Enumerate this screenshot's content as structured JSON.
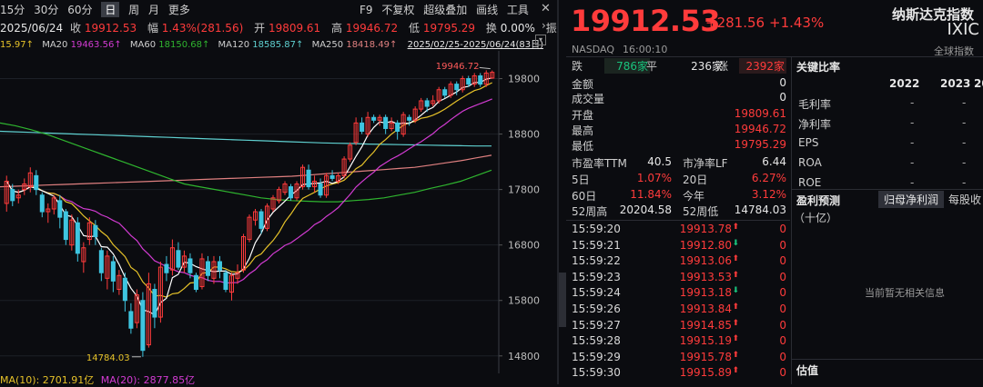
{
  "toolbar": {
    "period_tabs": [
      "15分",
      "30分",
      "60分",
      "日",
      "周",
      "月",
      "更多"
    ],
    "date": "2025/06/24",
    "close_label": "收",
    "close_value": "19912.53",
    "range_label": "幅",
    "range_value": "1.43%(281.56)",
    "open_label": "开",
    "open_value": "19809.61",
    "high_label": "高",
    "high_value": "19946.72",
    "low_label": "低",
    "low_value": "19795.29",
    "turnover_label": "换",
    "turnover_value": "0.00%",
    "more_label": "振",
    "f9": "F9",
    "fuquan": "不复权",
    "overlay": "超级叠加",
    "draw": "画线",
    "tools": "工具"
  },
  "ma_legend": {
    "ma5": "15.97↑",
    "ma20_label": "MA20",
    "ma20": "19463.56↑",
    "ma60_label": "MA60",
    "ma60": "18150.68↑",
    "ma120_label": "MA120",
    "ma120": "18585.87↑",
    "ma250_label": "MA250",
    "ma250": "18418.49↑",
    "range": "2025/02/25-2025/06/24(83日)"
  },
  "volume_legend": {
    "ma10": "MA(10): 2701.91亿",
    "ma20": "MA(20): 2877.85亿"
  },
  "chart_data": {
    "type": "candlestick",
    "y_ticks": [
      "19800",
      "18800",
      "17800",
      "16800",
      "15800",
      "14800"
    ],
    "ylim": [
      14600,
      20300
    ],
    "high_annotation": "19946.72",
    "low_annotation": "14784.03",
    "candles": [
      [
        17550,
        17950,
        17400,
        18050
      ],
      [
        17800,
        17600,
        17500,
        17900
      ],
      [
        17650,
        17700,
        17550,
        17800
      ],
      [
        17800,
        17900,
        17700,
        18000
      ],
      [
        17850,
        18100,
        17750,
        18200
      ],
      [
        18050,
        17800,
        17700,
        18150
      ],
      [
        17700,
        17400,
        17300,
        17750
      ],
      [
        17400,
        17450,
        17200,
        17550
      ],
      [
        17450,
        17650,
        17350,
        17700
      ],
      [
        17600,
        17300,
        17100,
        17700
      ],
      [
        17400,
        16900,
        16800,
        17450
      ],
      [
        16800,
        17250,
        16700,
        17350
      ],
      [
        17200,
        16650,
        16500,
        17300
      ],
      [
        16500,
        16750,
        16300,
        16850
      ],
      [
        16900,
        17200,
        16800,
        17300
      ],
      [
        17150,
        16950,
        16800,
        17250
      ],
      [
        16700,
        16300,
        16150,
        16750
      ],
      [
        16200,
        16600,
        16000,
        16700
      ],
      [
        16500,
        16150,
        15950,
        16600
      ],
      [
        16000,
        16250,
        15900,
        16350
      ],
      [
        16200,
        15800,
        15600,
        16300
      ],
      [
        15600,
        15300,
        15200,
        15750
      ],
      [
        15400,
        15900,
        15300,
        16000
      ],
      [
        15800,
        14900,
        14784,
        15950
      ],
      [
        15000,
        16100,
        14950,
        16300
      ],
      [
        16000,
        15500,
        15300,
        16100
      ],
      [
        15500,
        16400,
        15400,
        16500
      ],
      [
        16450,
        16300,
        16150,
        16600
      ],
      [
        16350,
        16750,
        16250,
        16900
      ],
      [
        16700,
        16400,
        16350,
        16850
      ],
      [
        16400,
        16600,
        16300,
        16700
      ],
      [
        16550,
        16300,
        16200,
        16650
      ],
      [
        16250,
        16000,
        15950,
        16300
      ],
      [
        16050,
        16550,
        16000,
        16650
      ],
      [
        16500,
        16250,
        16150,
        16600
      ],
      [
        16200,
        16500,
        16100,
        16600
      ],
      [
        16500,
        16350,
        16200,
        16600
      ],
      [
        16300,
        16000,
        15950,
        16350
      ],
      [
        15950,
        16250,
        15800,
        16300
      ],
      [
        16200,
        16300,
        16100,
        16450
      ],
      [
        16350,
        16950,
        16300,
        17000
      ],
      [
        16900,
        17300,
        16850,
        17350
      ],
      [
        17250,
        17400,
        17150,
        17450
      ],
      [
        17400,
        17100,
        17000,
        17450
      ],
      [
        17100,
        17500,
        17050,
        17550
      ],
      [
        17450,
        17650,
        17400,
        17700
      ],
      [
        17600,
        17800,
        17550,
        17850
      ],
      [
        17750,
        17900,
        17700,
        17950
      ],
      [
        17850,
        17650,
        17600,
        17900
      ],
      [
        17650,
        17900,
        17600,
        17950
      ],
      [
        17850,
        18200,
        17800,
        18250
      ],
      [
        18150,
        17850,
        17800,
        18250
      ],
      [
        17850,
        17950,
        17750,
        18050
      ],
      [
        17900,
        17700,
        17650,
        18000
      ],
      [
        17700,
        18050,
        17650,
        18100
      ],
      [
        18050,
        18000,
        17950,
        18150
      ],
      [
        17950,
        18050,
        17900,
        18100
      ],
      [
        18050,
        18350,
        18000,
        18400
      ],
      [
        18350,
        18600,
        18300,
        18650
      ],
      [
        18650,
        19000,
        18600,
        19100
      ],
      [
        19000,
        18850,
        18800,
        19100
      ],
      [
        18800,
        19100,
        18750,
        19200
      ],
      [
        19100,
        19050,
        19000,
        19150
      ],
      [
        19050,
        19100,
        18950,
        19150
      ],
      [
        19100,
        18900,
        18800,
        19150
      ],
      [
        18900,
        19000,
        18850,
        19100
      ],
      [
        19000,
        18850,
        18700,
        19050
      ],
      [
        18800,
        19150,
        18750,
        19200
      ],
      [
        19100,
        19050,
        18950,
        19150
      ],
      [
        19050,
        19250,
        19000,
        19300
      ],
      [
        19250,
        19400,
        19200,
        19450
      ],
      [
        19400,
        19300,
        19200,
        19450
      ],
      [
        19350,
        19400,
        19300,
        19500
      ],
      [
        19400,
        19600,
        19350,
        19650
      ],
      [
        19600,
        19500,
        19450,
        19650
      ],
      [
        19500,
        19700,
        19450,
        19750
      ],
      [
        19700,
        19600,
        19500,
        19750
      ],
      [
        19600,
        19800,
        19550,
        19850
      ],
      [
        19800,
        19700,
        19650,
        19850
      ],
      [
        19700,
        19850,
        19650,
        19900
      ],
      [
        19850,
        19700,
        19650,
        19900
      ],
      [
        19700,
        19900,
        19650,
        19950
      ],
      [
        19809.61,
        19912.53,
        19795.29,
        19946.72
      ]
    ],
    "ma_colors": {
      "ma5": "#ffffff",
      "ma10": "#e6c229",
      "ma20": "#d23bd2",
      "ma60": "#2fb52f",
      "ma120": "#5fd0d0",
      "ma250": "#e08080"
    },
    "ma_lines": {
      "ma120": [
        18850,
        18840,
        18830,
        18820,
        18810,
        18800,
        18790,
        18780,
        18770,
        18760,
        18750,
        18740,
        18730,
        18720,
        18710,
        18700,
        18690,
        18680,
        18670,
        18660,
        18650,
        18640,
        18635,
        18630,
        18620,
        18615,
        18610,
        18605,
        18600,
        18595,
        18590,
        18585,
        18585
      ],
      "ma250": [
        17850,
        17860,
        17870,
        17880,
        17890,
        17900,
        17910,
        17920,
        17930,
        17940,
        17950,
        17960,
        17970,
        17980,
        17990,
        18000,
        18010,
        18020,
        18030,
        18040,
        18060,
        18080,
        18100,
        18120,
        18140,
        18160,
        18180,
        18200,
        18240,
        18280,
        18320,
        18370,
        18418
      ],
      "ma60": [
        19000,
        18950,
        18880,
        18800,
        18700,
        18600,
        18500,
        18400,
        18300,
        18200,
        18100,
        18000,
        17900,
        17850,
        17800,
        17750,
        17700,
        17650,
        17620,
        17600,
        17590,
        17580,
        17580,
        17600,
        17620,
        17650,
        17700,
        17750,
        17820,
        17880,
        17950,
        18050,
        18150
      ]
    }
  },
  "quote": {
    "price": "19912.53",
    "change": "+281.56",
    "change_pct": "+1.43%",
    "name": "纳斯达克指数",
    "code": "IXIC",
    "exchange": "NASDAQ",
    "time": "16:00:10",
    "global": "全球指数"
  },
  "breadth": {
    "down_label": "跌",
    "down": "786家",
    "flat_label": "平",
    "flat": "236家",
    "up_label": "涨",
    "up": "2392家"
  },
  "stats": {
    "amount_label": "金额",
    "amount": "0",
    "volume_label": "成交量",
    "volume": "0",
    "open_label": "开盘",
    "open": "19809.61",
    "high_label": "最高",
    "high": "19946.72",
    "low_label": "最低",
    "low": "19795.29",
    "pe_label": "市盈率TTM",
    "pe": "40.5",
    "pb_label": "市净率LF",
    "pb": "6.44",
    "d5_label": "5日",
    "d5": "1.07%",
    "d20_label": "20日",
    "d20": "6.27%",
    "d60_label": "60日",
    "d60": "11.84%",
    "ytd_label": "今年",
    "ytd": "3.12%",
    "w52h_label": "52周高",
    "w52h": "20204.58",
    "w52l_label": "52周低",
    "w52l": "14784.03"
  },
  "ticks": [
    {
      "time": "15:59:20",
      "price": "19913.78",
      "dir": "up",
      "vol": "0"
    },
    {
      "time": "15:59:21",
      "price": "19912.80",
      "dir": "down",
      "vol": "0"
    },
    {
      "time": "15:59:22",
      "price": "19913.06",
      "dir": "up",
      "vol": "0"
    },
    {
      "time": "15:59:23",
      "price": "19913.53",
      "dir": "up",
      "vol": "0"
    },
    {
      "time": "15:59:24",
      "price": "19913.18",
      "dir": "down",
      "vol": "0"
    },
    {
      "time": "15:59:26",
      "price": "19913.84",
      "dir": "up",
      "vol": "0"
    },
    {
      "time": "15:59:27",
      "price": "19914.85",
      "dir": "up",
      "vol": "0"
    },
    {
      "time": "15:59:28",
      "price": "19915.19",
      "dir": "up",
      "vol": "0"
    },
    {
      "time": "15:59:29",
      "price": "19915.78",
      "dir": "up",
      "vol": "0"
    },
    {
      "time": "15:59:30",
      "price": "19915.89",
      "dir": "up",
      "vol": "0"
    }
  ],
  "ratios": {
    "title": "关键比率",
    "years": [
      "2022",
      "2023",
      "20"
    ],
    "rows": [
      {
        "label": "毛利率",
        "vals": [
          "-",
          "-"
        ]
      },
      {
        "label": "净利率",
        "vals": [
          "-",
          "-"
        ]
      },
      {
        "label": "EPS",
        "vals": [
          "-",
          "-"
        ]
      },
      {
        "label": "ROA",
        "vals": [
          "-",
          "-"
        ]
      },
      {
        "label": "ROE",
        "vals": [
          "-",
          "-"
        ]
      }
    ]
  },
  "forecast": {
    "title": "盈利预测",
    "tab1": "归母净利润",
    "tab2": "每股收",
    "unit": "（十亿）",
    "empty": "当前暂无相关信息"
  },
  "valuation": {
    "title": "估值"
  }
}
